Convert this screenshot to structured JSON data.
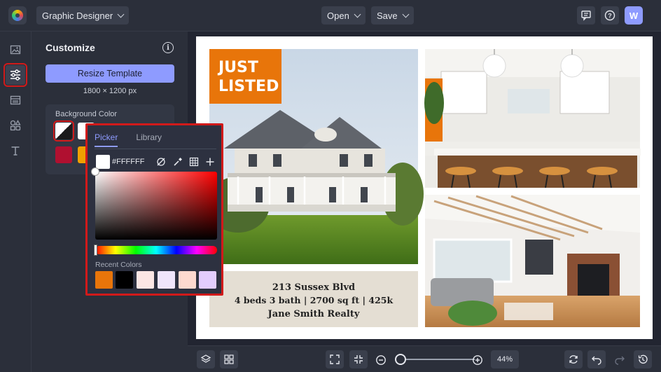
{
  "header": {
    "project_name": "Graphic Designer",
    "open_label": "Open",
    "save_label": "Save",
    "avatar_initial": "W"
  },
  "panel": {
    "title": "Customize",
    "resize_button": "Resize Template",
    "dimensions": "1800 × 1200 px",
    "bg_color_label": "Background Color",
    "bg_swatches": [
      "#ffffff",
      "#b01030",
      "#f0a000"
    ]
  },
  "picker": {
    "tab_picker": "Picker",
    "tab_library": "Library",
    "hex_value": "#FFFFFF",
    "recent_label": "Recent Colors",
    "recent_colors": [
      "#e8750a",
      "#000000",
      "#fbe6e4",
      "#efe5fb",
      "#fdd9cf",
      "#e3cdfd"
    ]
  },
  "design": {
    "badge_line1": "JUST",
    "badge_line2": "LISTED",
    "address": "213 Sussex Blvd",
    "details": "4 beds 3 bath | 2700 sq ft | 425k",
    "realtor": "Jane Smith Realty",
    "accent_color": "#e8750a"
  },
  "footer": {
    "zoom": "44%"
  }
}
